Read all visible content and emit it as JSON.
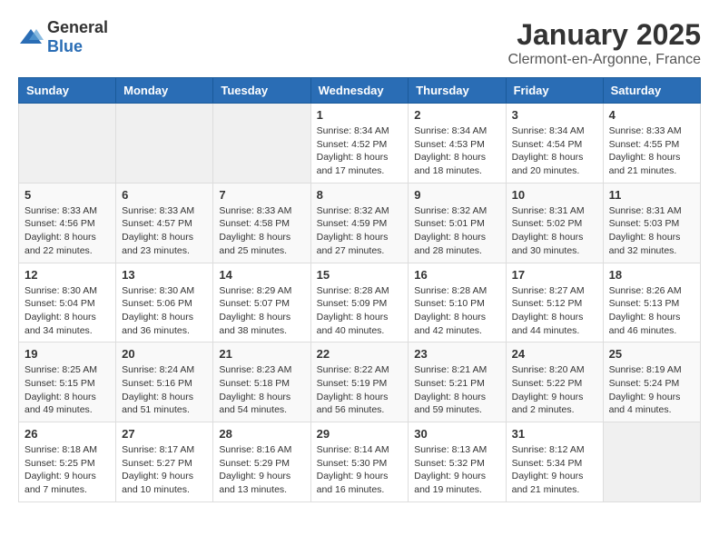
{
  "logo": {
    "text_general": "General",
    "text_blue": "Blue"
  },
  "header": {
    "month": "January 2025",
    "location": "Clermont-en-Argonne, France"
  },
  "weekdays": [
    "Sunday",
    "Monday",
    "Tuesday",
    "Wednesday",
    "Thursday",
    "Friday",
    "Saturday"
  ],
  "weeks": [
    [
      {
        "day": "",
        "info": ""
      },
      {
        "day": "",
        "info": ""
      },
      {
        "day": "",
        "info": ""
      },
      {
        "day": "1",
        "info": "Sunrise: 8:34 AM\nSunset: 4:52 PM\nDaylight: 8 hours\nand 17 minutes."
      },
      {
        "day": "2",
        "info": "Sunrise: 8:34 AM\nSunset: 4:53 PM\nDaylight: 8 hours\nand 18 minutes."
      },
      {
        "day": "3",
        "info": "Sunrise: 8:34 AM\nSunset: 4:54 PM\nDaylight: 8 hours\nand 20 minutes."
      },
      {
        "day": "4",
        "info": "Sunrise: 8:33 AM\nSunset: 4:55 PM\nDaylight: 8 hours\nand 21 minutes."
      }
    ],
    [
      {
        "day": "5",
        "info": "Sunrise: 8:33 AM\nSunset: 4:56 PM\nDaylight: 8 hours\nand 22 minutes."
      },
      {
        "day": "6",
        "info": "Sunrise: 8:33 AM\nSunset: 4:57 PM\nDaylight: 8 hours\nand 23 minutes."
      },
      {
        "day": "7",
        "info": "Sunrise: 8:33 AM\nSunset: 4:58 PM\nDaylight: 8 hours\nand 25 minutes."
      },
      {
        "day": "8",
        "info": "Sunrise: 8:32 AM\nSunset: 4:59 PM\nDaylight: 8 hours\nand 27 minutes."
      },
      {
        "day": "9",
        "info": "Sunrise: 8:32 AM\nSunset: 5:01 PM\nDaylight: 8 hours\nand 28 minutes."
      },
      {
        "day": "10",
        "info": "Sunrise: 8:31 AM\nSunset: 5:02 PM\nDaylight: 8 hours\nand 30 minutes."
      },
      {
        "day": "11",
        "info": "Sunrise: 8:31 AM\nSunset: 5:03 PM\nDaylight: 8 hours\nand 32 minutes."
      }
    ],
    [
      {
        "day": "12",
        "info": "Sunrise: 8:30 AM\nSunset: 5:04 PM\nDaylight: 8 hours\nand 34 minutes."
      },
      {
        "day": "13",
        "info": "Sunrise: 8:30 AM\nSunset: 5:06 PM\nDaylight: 8 hours\nand 36 minutes."
      },
      {
        "day": "14",
        "info": "Sunrise: 8:29 AM\nSunset: 5:07 PM\nDaylight: 8 hours\nand 38 minutes."
      },
      {
        "day": "15",
        "info": "Sunrise: 8:28 AM\nSunset: 5:09 PM\nDaylight: 8 hours\nand 40 minutes."
      },
      {
        "day": "16",
        "info": "Sunrise: 8:28 AM\nSunset: 5:10 PM\nDaylight: 8 hours\nand 42 minutes."
      },
      {
        "day": "17",
        "info": "Sunrise: 8:27 AM\nSunset: 5:12 PM\nDaylight: 8 hours\nand 44 minutes."
      },
      {
        "day": "18",
        "info": "Sunrise: 8:26 AM\nSunset: 5:13 PM\nDaylight: 8 hours\nand 46 minutes."
      }
    ],
    [
      {
        "day": "19",
        "info": "Sunrise: 8:25 AM\nSunset: 5:15 PM\nDaylight: 8 hours\nand 49 minutes."
      },
      {
        "day": "20",
        "info": "Sunrise: 8:24 AM\nSunset: 5:16 PM\nDaylight: 8 hours\nand 51 minutes."
      },
      {
        "day": "21",
        "info": "Sunrise: 8:23 AM\nSunset: 5:18 PM\nDaylight: 8 hours\nand 54 minutes."
      },
      {
        "day": "22",
        "info": "Sunrise: 8:22 AM\nSunset: 5:19 PM\nDaylight: 8 hours\nand 56 minutes."
      },
      {
        "day": "23",
        "info": "Sunrise: 8:21 AM\nSunset: 5:21 PM\nDaylight: 8 hours\nand 59 minutes."
      },
      {
        "day": "24",
        "info": "Sunrise: 8:20 AM\nSunset: 5:22 PM\nDaylight: 9 hours\nand 2 minutes."
      },
      {
        "day": "25",
        "info": "Sunrise: 8:19 AM\nSunset: 5:24 PM\nDaylight: 9 hours\nand 4 minutes."
      }
    ],
    [
      {
        "day": "26",
        "info": "Sunrise: 8:18 AM\nSunset: 5:25 PM\nDaylight: 9 hours\nand 7 minutes."
      },
      {
        "day": "27",
        "info": "Sunrise: 8:17 AM\nSunset: 5:27 PM\nDaylight: 9 hours\nand 10 minutes."
      },
      {
        "day": "28",
        "info": "Sunrise: 8:16 AM\nSunset: 5:29 PM\nDaylight: 9 hours\nand 13 minutes."
      },
      {
        "day": "29",
        "info": "Sunrise: 8:14 AM\nSunset: 5:30 PM\nDaylight: 9 hours\nand 16 minutes."
      },
      {
        "day": "30",
        "info": "Sunrise: 8:13 AM\nSunset: 5:32 PM\nDaylight: 9 hours\nand 19 minutes."
      },
      {
        "day": "31",
        "info": "Sunrise: 8:12 AM\nSunset: 5:34 PM\nDaylight: 9 hours\nand 21 minutes."
      },
      {
        "day": "",
        "info": ""
      }
    ]
  ]
}
